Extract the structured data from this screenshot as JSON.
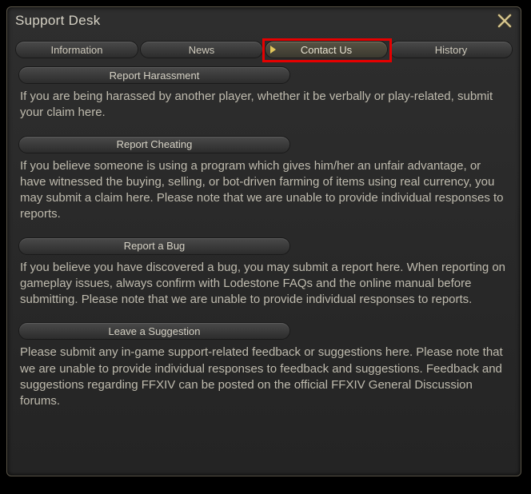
{
  "window": {
    "title": "Support Desk"
  },
  "tabs": {
    "items": [
      {
        "label": "Information"
      },
      {
        "label": "News"
      },
      {
        "label": "Contact Us"
      },
      {
        "label": "History"
      }
    ],
    "activeIndex": 2
  },
  "sections": [
    {
      "title": "Report Harassment",
      "body": "If you are being harassed by another player, whether it be verbally or play-related, submit your claim here."
    },
    {
      "title": "Report Cheating",
      "body": "If you believe someone is using a program which gives him/her an unfair advantage, or have witnessed the buying, selling, or bot-driven farming of items using real currency, you may submit a claim here. Please note that we are unable to provide individual responses to reports."
    },
    {
      "title": "Report a Bug",
      "body": "If you believe you have discovered a bug, you may submit a report here. When reporting on gameplay issues, always confirm with Lodestone FAQs and the online manual before submitting. Please note that we are unable to provide individual responses to reports."
    },
    {
      "title": "Leave a Suggestion",
      "body": "Please submit any in-game support-related feedback or suggestions here. Please note that we are unable to provide individual responses to feedback and suggestions. Feedback and suggestions regarding FFXIV can be posted on the official FFXIV General Discussion forums."
    }
  ],
  "highlight": {
    "tabIndex": 2
  }
}
